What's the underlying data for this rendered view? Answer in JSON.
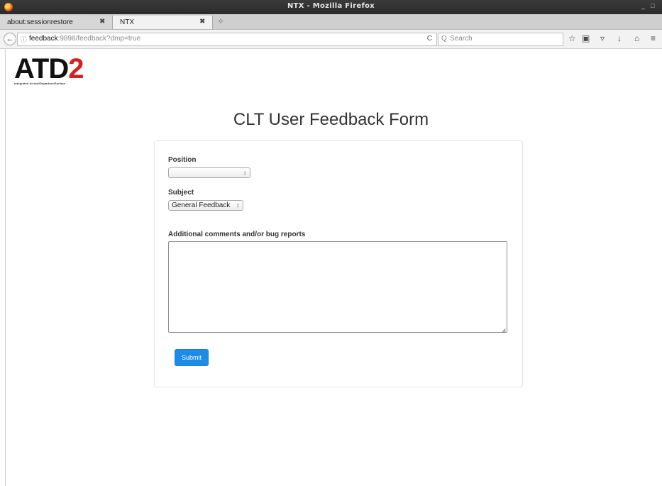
{
  "window": {
    "title": "NTX - Mozilla Firefox",
    "controls": [
      "_",
      "□"
    ]
  },
  "tabs": [
    {
      "label": "about:sessionrestore",
      "close": "✖"
    },
    {
      "label": "NTX",
      "close": "✖"
    }
  ],
  "newtab_icon": "✧",
  "navbar": {
    "back_glyph": "←",
    "info_glyph": "ⓘ",
    "url_host": "feedback",
    "url_rest": ":9898/feedback?dmp=true",
    "reload_glyph": "C",
    "search_placeholder": "Search",
    "search_glyph": "Q",
    "icons": {
      "bookmark": "☆",
      "library": "▣",
      "pocket": "▿",
      "download": "↓",
      "home": "⌂",
      "menu": "≡"
    }
  },
  "logo": {
    "text_main": "ATD",
    "text_two": "2",
    "subtitle": "Integrated Arrival/Departure/Surface"
  },
  "page": {
    "title": "CLT User Feedback Form",
    "form": {
      "position_label": "Position",
      "position_value": "",
      "subject_label": "Subject",
      "subject_value": "General Feedback",
      "comments_label": "Additional comments and/or bug reports",
      "comments_value": "",
      "submit_label": "Submit",
      "select_arrow": "↕"
    }
  },
  "colors": {
    "accent": "#1d8be8",
    "logo_red": "#d42121"
  }
}
